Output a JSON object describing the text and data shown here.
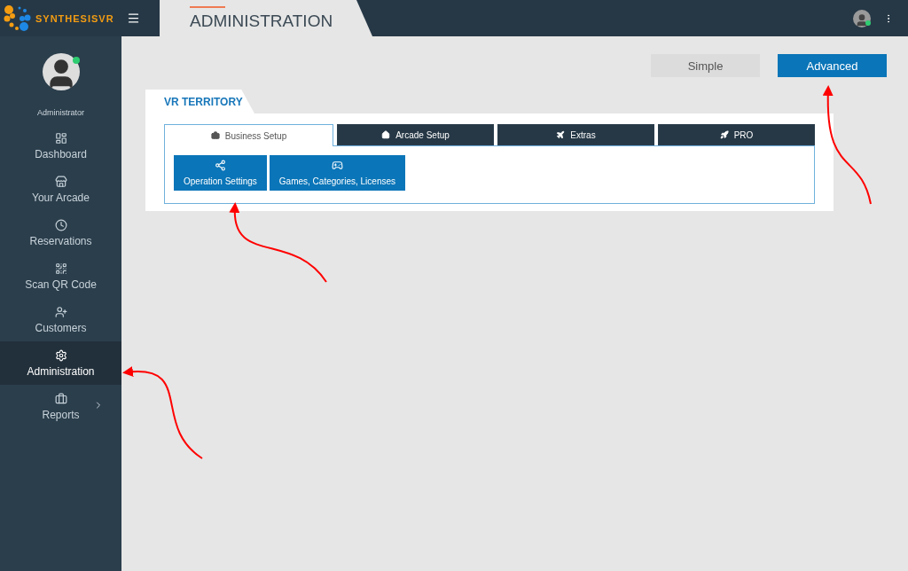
{
  "brand": {
    "name": "SYNTHESISVR"
  },
  "page_title": "ADMINISTRATION",
  "user": {
    "role": "Administrator",
    "online": true
  },
  "sidebar": {
    "items": [
      {
        "label": "Dashboard",
        "selected": false,
        "submenu": false
      },
      {
        "label": "Your Arcade",
        "selected": false,
        "submenu": false
      },
      {
        "label": "Reservations",
        "selected": false,
        "submenu": false
      },
      {
        "label": "Scan QR Code",
        "selected": false,
        "submenu": false
      },
      {
        "label": "Customers",
        "selected": false,
        "submenu": false
      },
      {
        "label": "Administration",
        "selected": true,
        "submenu": false
      },
      {
        "label": "Reports",
        "selected": false,
        "submenu": true
      }
    ]
  },
  "modes": [
    {
      "label": "Simple",
      "selected": false
    },
    {
      "label": "Advanced",
      "selected": true
    }
  ],
  "panel": {
    "title": "VR TERRITORY",
    "tabs": [
      {
        "label": "Business Setup",
        "selected": true
      },
      {
        "label": "Arcade Setup",
        "selected": false
      },
      {
        "label": "Extras",
        "selected": false
      },
      {
        "label": "PRO",
        "selected": false
      }
    ],
    "actions": [
      "Operation Settings",
      "Games, Categories, Licenses"
    ]
  }
}
